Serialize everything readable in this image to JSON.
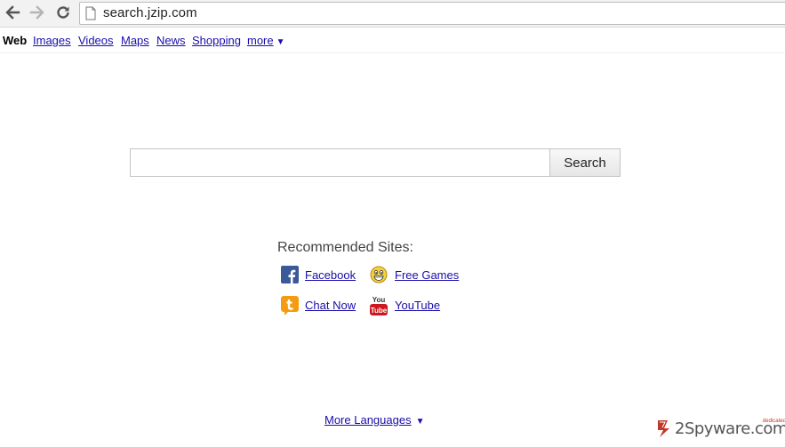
{
  "browser": {
    "url": "search.jzip.com"
  },
  "topnav": {
    "items": [
      {
        "label": "Web",
        "active": true
      },
      {
        "label": "Images"
      },
      {
        "label": "Videos"
      },
      {
        "label": "Maps"
      },
      {
        "label": "News"
      },
      {
        "label": "Shopping"
      }
    ],
    "more_label": "more",
    "more_caret": "▼"
  },
  "search": {
    "value": "",
    "button_label": "Search"
  },
  "recommended": {
    "title": "Recommended Sites:",
    "sites": [
      {
        "label": "Facebook",
        "icon": "facebook-icon"
      },
      {
        "label": "Free Games",
        "icon": "smiley-icon"
      },
      {
        "label": "Chat Now",
        "icon": "chat-icon"
      },
      {
        "label": "YouTube",
        "icon": "youtube-icon"
      }
    ]
  },
  "footer": {
    "more_languages": "More Languages",
    "caret": "▼"
  },
  "watermark": {
    "logo_text": "2Spyware.com",
    "badge": "dedicated"
  },
  "colors": {
    "link": "#1a0dab",
    "chrome_bg": "#f2f2f2",
    "facebook": "#3b5998",
    "youtube": "#cc181e",
    "chat": "#f39c12"
  }
}
